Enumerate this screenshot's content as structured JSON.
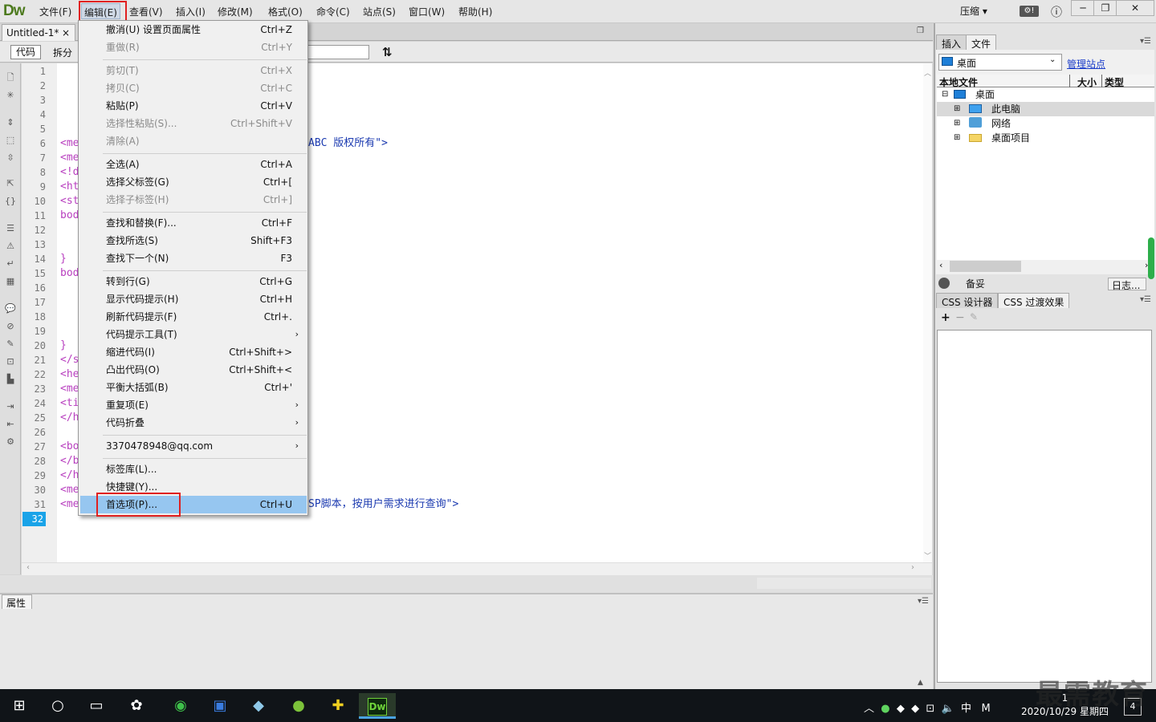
{
  "app": {
    "logo": "Dw"
  },
  "menubar": {
    "items": [
      "文件(F)",
      "编辑(E)",
      "查看(V)",
      "插入(I)",
      "修改(M)",
      "格式(O)",
      "命令(C)",
      "站点(S)",
      "窗口(W)",
      "帮助(H)"
    ],
    "compress": "压缩"
  },
  "document": {
    "tab_title": "Untitled-1*",
    "close": "×"
  },
  "toolbar": {
    "code": "代码",
    "split": "拆分"
  },
  "editor": {
    "line_numbers": [
      "1",
      "2",
      "3",
      "4",
      "5",
      "6",
      "7",
      "8",
      "9",
      "10",
      "11",
      "12",
      "13",
      "14",
      "15",
      "16",
      "17",
      "18",
      "19",
      "20",
      "21",
      "22",
      "23",
      "24",
      "25",
      "26",
      "27",
      "28",
      "29",
      "30",
      "31",
      "32"
    ],
    "line6_tag": "<me",
    "line6_tail": "ABC 版权所有\">",
    "line7": "<me",
    "line8": "<!d",
    "line9": "<ht",
    "line10": "<st",
    "line11": "bod",
    "line14": "}",
    "line15": "bod",
    "line20": "}",
    "line21": "</s",
    "line22": "<he",
    "line23": "<me",
    "line24": "<ti",
    "line25": "</h",
    "line27": "<bo",
    "line28": "</b",
    "line29": "</h",
    "line30": "<me",
    "line31": "<me",
    "line31_tail": "SP脚本，按用户需求进行查询\">"
  },
  "edit_menu": {
    "items": [
      {
        "label": "撤消(U) 设置页面属性",
        "shortcut": "Ctrl+Z"
      },
      {
        "label": "重做(R)",
        "shortcut": "Ctrl+Y"
      },
      {
        "label": "剪切(T)",
        "shortcut": "Ctrl+X"
      },
      {
        "label": "拷贝(C)",
        "shortcut": "Ctrl+C"
      },
      {
        "label": "粘贴(P)",
        "shortcut": "Ctrl+V"
      },
      {
        "label": "选择性粘贴(S)...",
        "shortcut": "Ctrl+Shift+V"
      },
      {
        "label": "清除(A)",
        "shortcut": ""
      },
      {
        "label": "全选(A)",
        "shortcut": "Ctrl+A"
      },
      {
        "label": "选择父标签(G)",
        "shortcut": "Ctrl+["
      },
      {
        "label": "选择子标签(H)",
        "shortcut": "Ctrl+]"
      },
      {
        "label": "查找和替换(F)...",
        "shortcut": "Ctrl+F"
      },
      {
        "label": "查找所选(S)",
        "shortcut": "Shift+F3"
      },
      {
        "label": "查找下一个(N)",
        "shortcut": "F3"
      },
      {
        "label": "转到行(G)",
        "shortcut": "Ctrl+G"
      },
      {
        "label": "显示代码提示(H)",
        "shortcut": "Ctrl+H"
      },
      {
        "label": "刷新代码提示(F)",
        "shortcut": "Ctrl+."
      },
      {
        "label": "代码提示工具(T)",
        "shortcut": ""
      },
      {
        "label": "缩进代码(I)",
        "shortcut": "Ctrl+Shift+>"
      },
      {
        "label": "凸出代码(O)",
        "shortcut": "Ctrl+Shift+<"
      },
      {
        "label": "平衡大括弧(B)",
        "shortcut": "Ctrl+'"
      },
      {
        "label": "重复项(E)",
        "shortcut": ""
      },
      {
        "label": "代码折叠",
        "shortcut": ""
      },
      {
        "label": "3370478948@qq.com",
        "shortcut": ""
      },
      {
        "label": "标签库(L)...",
        "shortcut": ""
      },
      {
        "label": "快捷键(Y)...",
        "shortcut": ""
      },
      {
        "label": "首选项(P)...",
        "shortcut": "Ctrl+U"
      }
    ]
  },
  "files_panel": {
    "tab_insert": "插入",
    "tab_files": "文件",
    "site": "桌面",
    "manage_sites": "管理站点",
    "col_local": "本地文件",
    "col_size": "大小",
    "col_type": "类型",
    "tree": [
      "桌面",
      "此电脑",
      "网络",
      "桌面项目"
    ],
    "status": "备妥",
    "log": "日志..."
  },
  "css_panel": {
    "tab_designer": "CSS 设计器",
    "tab_transitions": "CSS 过渡效果"
  },
  "properties": {
    "tab": "属性"
  },
  "taskbar": {
    "tray_ime": "中",
    "tray_m": "M",
    "time": "1",
    "date": "2020/10/29 星期四",
    "notif_count": "4"
  },
  "watermark": "最需教育"
}
